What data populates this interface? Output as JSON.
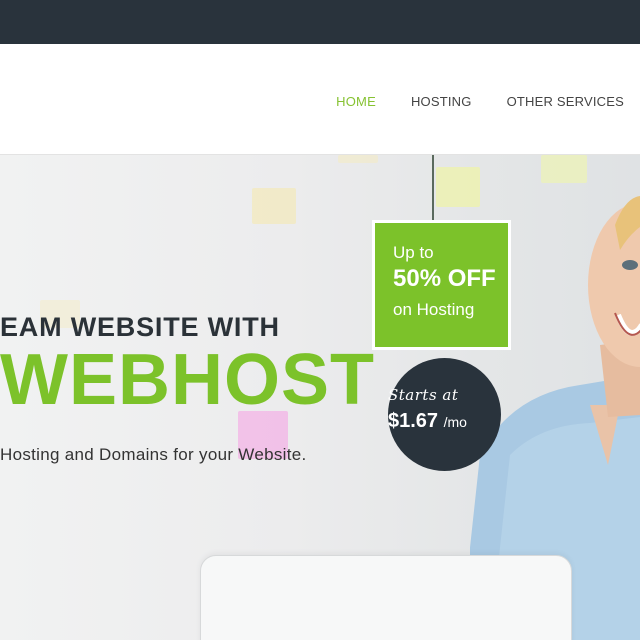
{
  "nav": {
    "items": [
      "HOME",
      "HOSTING",
      "OTHER SERVICES"
    ],
    "active_color": "#86c232"
  },
  "hero": {
    "headline_line1": "EAM WEBSITE WITH",
    "headline_line2": "WEBHOST",
    "tagline": "Hosting and Domains for your Website."
  },
  "promo_tag": {
    "line1": "Up to",
    "line2": "50% OFF",
    "line3": "on Hosting"
  },
  "price_badge": {
    "starts": "Starts at",
    "price": "$1.67",
    "per": "/mo"
  },
  "colors": {
    "brand_green": "#7cc22a",
    "dark": "#29333c"
  }
}
